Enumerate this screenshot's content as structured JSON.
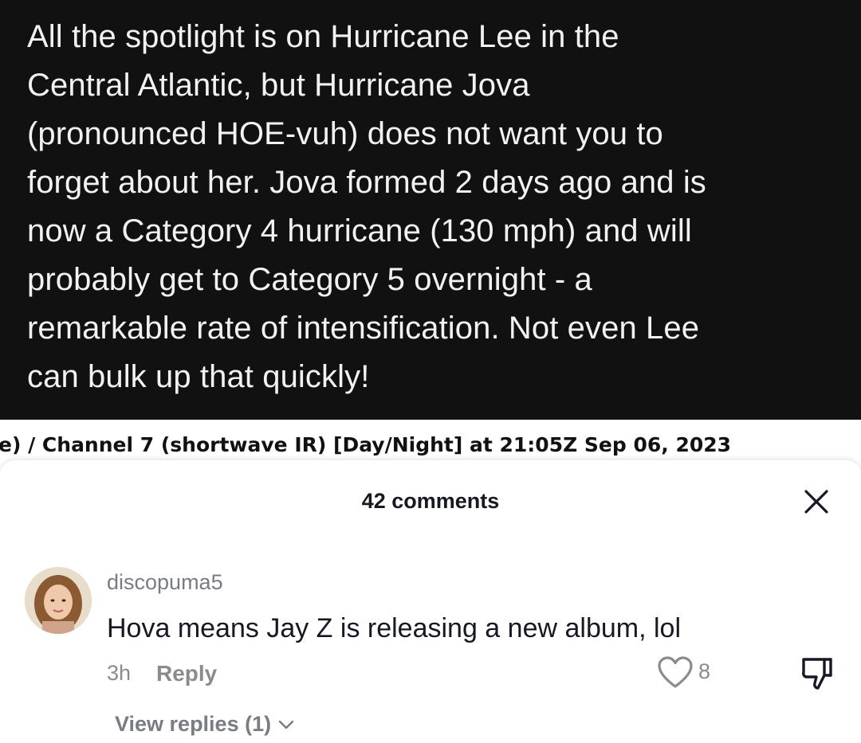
{
  "video": {
    "overlay_text": "All the spotlight is on Hurricane Lee in the\nCentral Atlantic, but Hurricane Jova\n(pronounced HOE-vuh) does not want you to\nforget about her. Jova formed 2 days ago and is\nnow a Category 4 hurricane (130 mph) and will\nprobably get to Category 5 overnight - a\nremarkable rate of intensification. Not even Lee\ncan bulk up that quickly!",
    "caption_strip": "e) / Channel 7 (shortwave IR) [Day/Night] at 21:05Z Sep 06, 2023"
  },
  "comments_sheet": {
    "title": "42 comments",
    "close_icon": "close-icon",
    "comments": [
      {
        "username": "discopuma5",
        "text": "Hova means Jay Z is releasing a new album, lol",
        "time": "3h",
        "reply_label": "Reply",
        "like_count": "8",
        "view_replies_label": "View replies (1)"
      }
    ]
  },
  "colors": {
    "video_bg": "#111111",
    "text_primary": "#161823",
    "text_secondary": "#8a8b91"
  }
}
